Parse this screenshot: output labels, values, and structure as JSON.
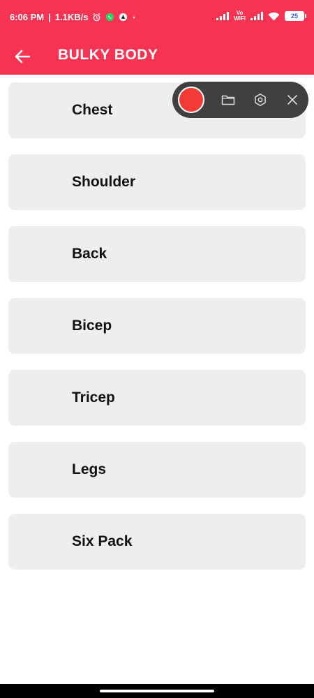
{
  "status_bar": {
    "time": "6:06 PM",
    "speed": "1.1KB/s",
    "battery_level": "25",
    "vowifi_top": "Vo",
    "vowifi_bottom": "WiFi"
  },
  "app_bar": {
    "title": "BULKY BODY",
    "background": "#f73353"
  },
  "categories": [
    {
      "label": "Chest"
    },
    {
      "label": "Shoulder"
    },
    {
      "label": "Back"
    },
    {
      "label": "Bicep"
    },
    {
      "label": "Tricep"
    },
    {
      "label": "Legs"
    },
    {
      "label": "Six Pack"
    }
  ],
  "recorder_toolbar": {
    "icons": [
      "record-icon",
      "folder-icon",
      "settings-icon",
      "close-icon"
    ]
  }
}
